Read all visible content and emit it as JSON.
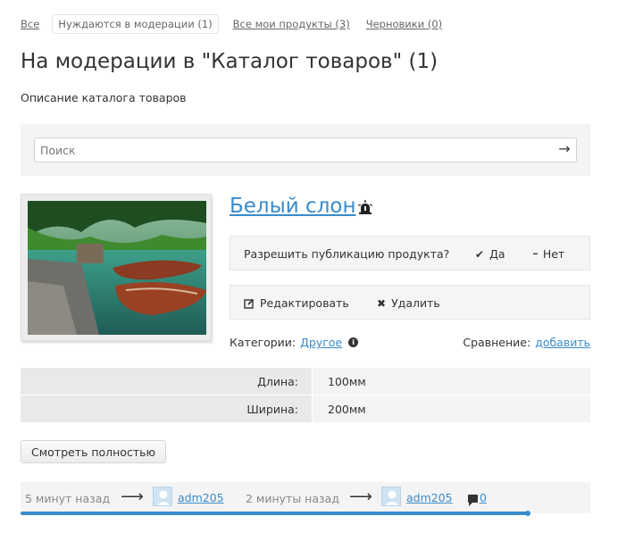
{
  "tabs": [
    {
      "label": "Все"
    },
    {
      "label": "Нуждаются в модерации (1)"
    },
    {
      "label": "Все мои продукты (3)"
    },
    {
      "label": "Черновики (0)"
    }
  ],
  "active_tab": 1,
  "page_title": "На модерации в \"Каталог товаров\" (1)",
  "catalog_description": "Описание каталога товаров",
  "search": {
    "placeholder": "Поиск",
    "submit_icon": "arrow-right-icon",
    "submit_glyph": "→"
  },
  "product": {
    "image_alt": "lake-with-boats-photo",
    "title": "Белый слон",
    "title_icon": "alarm-icon",
    "publish": {
      "question": "Разрешить публикацию продукта?",
      "yes_label": "Да",
      "no_label": "Нет",
      "yes_glyph": "✔",
      "no_glyph": "━"
    },
    "actions": {
      "edit_label": "Редактировать",
      "delete_label": "Удалить",
      "delete_glyph": "✖"
    },
    "categories": {
      "label": "Категории:",
      "value": "Другое",
      "info_glyph": "i"
    },
    "compare": {
      "label": "Сравнение:",
      "action": "добавить"
    },
    "specs": [
      {
        "key": "Длина:",
        "value": "100мм"
      },
      {
        "key": "Ширина:",
        "value": "200мм"
      }
    ],
    "view_full_label": "Смотреть полностью"
  },
  "history": {
    "created_time": "5 минут назад",
    "created_by": "adm205",
    "updated_time": "2 минуты назад",
    "updated_by": "adm205",
    "arrow_glyph": "⟶",
    "comments_count": "0",
    "progress": 1.0
  },
  "colors": {
    "accent": "#3a8bcb",
    "panel_bg": "#f5f5f5"
  }
}
